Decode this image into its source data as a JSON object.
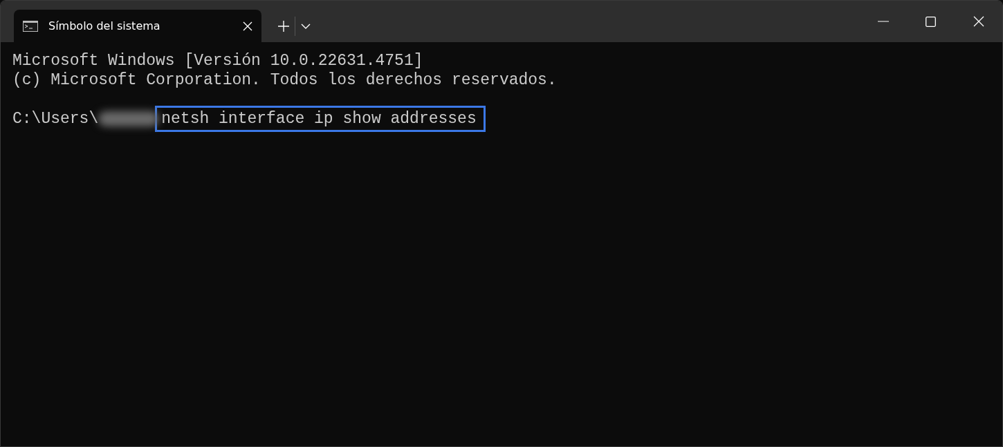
{
  "window": {
    "tab_title": "Símbolo del sistema"
  },
  "console": {
    "lines": [
      {
        "kind": "text",
        "text": "Microsoft Windows [Versión 10.0.22631.4751]"
      },
      {
        "kind": "text",
        "text": "(c) Microsoft Corporation. Todos los derechos reservados."
      },
      {
        "kind": "blank"
      },
      {
        "kind": "prompt",
        "prompt": "C:\\Users\\",
        "command": "netsh interface ip show addresses",
        "highlighted": true
      }
    ]
  }
}
